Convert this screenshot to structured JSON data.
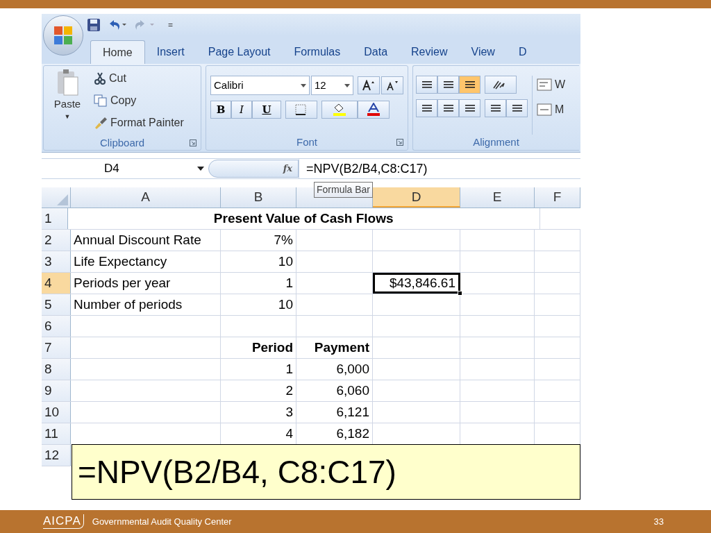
{
  "quick_access": {
    "menu_glyph": "="
  },
  "tabs": [
    {
      "label": "Home",
      "selected": true
    },
    {
      "label": "Insert",
      "selected": false
    },
    {
      "label": "Page Layout",
      "selected": false
    },
    {
      "label": "Formulas",
      "selected": false
    },
    {
      "label": "Data",
      "selected": false
    },
    {
      "label": "Review",
      "selected": false
    },
    {
      "label": "View",
      "selected": false
    },
    {
      "label": "D",
      "selected": false
    }
  ],
  "clipboard": {
    "paste": "Paste",
    "paste_caret": "▼",
    "cut": "Cut",
    "copy": "Copy",
    "format_painter": "Format Painter",
    "label": "Clipboard"
  },
  "font": {
    "name": "Calibri",
    "size": "12",
    "bold": "B",
    "italic": "I",
    "underline": "U",
    "label": "Font"
  },
  "alignment": {
    "vertical": [
      {
        "selected": false
      },
      {
        "selected": false
      },
      {
        "selected": true
      }
    ],
    "wrap": "W",
    "merge": "M",
    "label": "Alignment"
  },
  "formula_bar": {
    "name_box": "D4",
    "function_glyph": "fx",
    "formula": "=NPV(B2/B4,C8:C17)",
    "tooltip": "Formula Bar"
  },
  "columns": [
    {
      "label": "A",
      "selected": false
    },
    {
      "label": "B",
      "selected": false
    },
    {
      "selected": false
    },
    {
      "label": "D",
      "selected": true
    },
    {
      "label": "E",
      "selected": false
    },
    {
      "label": "F",
      "selected": false
    }
  ],
  "rows": [
    {
      "header": "1",
      "kind": "title",
      "selected": false,
      "title": "Present Value of Cash Flows"
    },
    {
      "header": "2",
      "kind": "data",
      "selected": false,
      "a": "Annual Discount Rate",
      "b": "7%"
    },
    {
      "header": "3",
      "kind": "data",
      "selected": false,
      "a": "Life Expectancy",
      "b": "10"
    },
    {
      "header": "4",
      "kind": "data",
      "selected": true,
      "a": "Periods per year",
      "b": "1",
      "d": "$43,846.61"
    },
    {
      "header": "5",
      "kind": "data",
      "selected": false,
      "a": "Number of periods",
      "b": "10"
    },
    {
      "header": "6",
      "kind": "data",
      "selected": false
    },
    {
      "header": "7",
      "kind": "heading",
      "selected": false,
      "b": "Period",
      "c": "Payment"
    },
    {
      "header": "8",
      "kind": "data",
      "selected": false,
      "b": "1",
      "c": "6,000"
    },
    {
      "header": "9",
      "kind": "data",
      "selected": false,
      "b": "2",
      "c": "6,060"
    },
    {
      "header": "10",
      "kind": "data",
      "selected": false,
      "b": "3",
      "c": "6,121"
    },
    {
      "header": "11",
      "kind": "data",
      "selected": false,
      "b": "4",
      "c": "6,182"
    },
    {
      "header": "12",
      "kind": "data",
      "selected": false
    }
  ],
  "callout": "=NPV(B2/B4, C8:C17)",
  "footer": {
    "logo": "AICPA",
    "title": "Governmental Audit Quality Center",
    "page": "33"
  }
}
